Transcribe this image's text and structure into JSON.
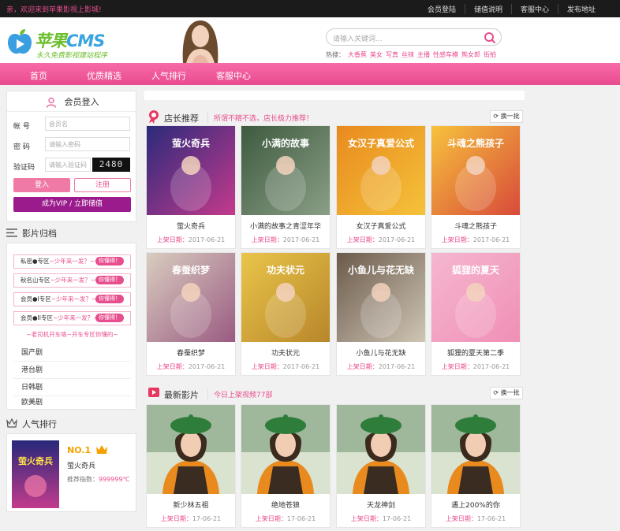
{
  "topbar": {
    "welcome": "亲，欢迎来到苹果影视上影城!",
    "links": [
      "会员登陆",
      "储值说明",
      "客服中心",
      "发布地址"
    ]
  },
  "header": {
    "logo_text_1": "苹果",
    "logo_text_2": "CMS",
    "slogan": "永久免费影视建站程序",
    "search_placeholder": "请输入关键词...",
    "hot_label": "热搜：",
    "hot_words": [
      "大香蕉",
      "美女",
      "写真",
      "丝袜",
      "主播",
      "性感车模",
      "熊女郎",
      "街拍"
    ]
  },
  "nav": [
    "首页",
    "优质精选",
    "人气排行",
    "客服中心"
  ],
  "login": {
    "title": "会员登入",
    "username_label": "帐 号",
    "username_placeholder": "会员名",
    "password_label": "密 码",
    "password_placeholder": "请输入密码",
    "captcha_label": "验证码",
    "captcha_placeholder": "请输入验证码",
    "captcha_code": "2480",
    "login_button": "登入",
    "register_button": "注册",
    "vip_button": "成为VIP / 立即储值"
  },
  "categories": {
    "title": "影片归档",
    "vip_zones": [
      {
        "name": "私密●专区",
        "slogan": "~少年来一发？~",
        "tag": "你懂得！"
      },
      {
        "name": "秋名山专区",
        "slogan": "~少年来一发？~",
        "tag": "你懂得！"
      },
      {
        "name": "会员●I专区",
        "slogan": "~少年来一发？~",
        "tag": "你懂得！"
      },
      {
        "name": "会员●II专区",
        "slogan": "~少年来一发？~",
        "tag": "你懂得！"
      }
    ],
    "vip_note": "~老司机开车咯~开车专区你懂的~",
    "items": [
      "国产剧",
      "港台剧",
      "日韩剧",
      "欧美剧"
    ]
  },
  "ranking": {
    "title": "人气排行",
    "rank": "NO.1",
    "name": "萤火奇兵",
    "score_label": "推荐指数：",
    "score_value": "999999℃",
    "poster_text": "萤火奇兵"
  },
  "recommend": {
    "title": "店长推荐",
    "subtitle": "所谓不精不选，店长极力推荐！",
    "refresh": "换一批",
    "date_label": "上架日期：",
    "movies": [
      {
        "title": "萤火奇兵",
        "date": "2017-06-21",
        "poster_text": "萤火奇兵",
        "bg1": "#2b2a7a",
        "bg2": "#c43a8d"
      },
      {
        "title": "小满的故事之青涩年华",
        "date": "2017-06-21",
        "poster_text": "小满的故事",
        "bg1": "#3d5a3f",
        "bg2": "#8a9f86"
      },
      {
        "title": "女汉子真爱公式",
        "date": "2017-06-21",
        "poster_text": "女汉子真爱公式",
        "bg1": "#e88a1e",
        "bg2": "#f5c23a"
      },
      {
        "title": "斗魂之熊孩子",
        "date": "2017-06-21",
        "poster_text": "斗魂之熊孩子",
        "bg1": "#f7c23c",
        "bg2": "#d84a3a"
      },
      {
        "title": "春蚕织梦",
        "date": "2017-06-21",
        "poster_text": "春蚕织梦",
        "bg1": "#d9cdbf",
        "bg2": "#9a5b82"
      },
      {
        "title": "功夫状元",
        "date": "2017-06-21",
        "poster_text": "功夫状元",
        "bg1": "#e9c54a",
        "bg2": "#b8862a"
      },
      {
        "title": "小鱼儿与花无缺",
        "date": "2017-06-21",
        "poster_text": "小鱼儿与花无缺",
        "bg1": "#6b5a4a",
        "bg2": "#cfc6b6"
      },
      {
        "title": "狐狸的夏天第二季",
        "date": "2017-06-21",
        "poster_text": "狐狸的夏天",
        "bg1": "#f5b7cf",
        "bg2": "#f08fb6"
      }
    ]
  },
  "latest": {
    "title": "最新影片",
    "subtitle": "今日上架视频77部",
    "refresh": "换一批",
    "date_label": "上架日期：",
    "movies": [
      {
        "title": "新少林五祖",
        "date": "17-06-21"
      },
      {
        "title": "绝地苍狼",
        "date": "17-06-21"
      },
      {
        "title": "天龙神剑",
        "date": "17-06-21"
      },
      {
        "title": "遇上200%的你",
        "date": "17-06-21"
      }
    ]
  },
  "colors": {
    "accent": "#e84d8e",
    "nav": "#f05a9a",
    "vip": "#9b1b8d"
  }
}
